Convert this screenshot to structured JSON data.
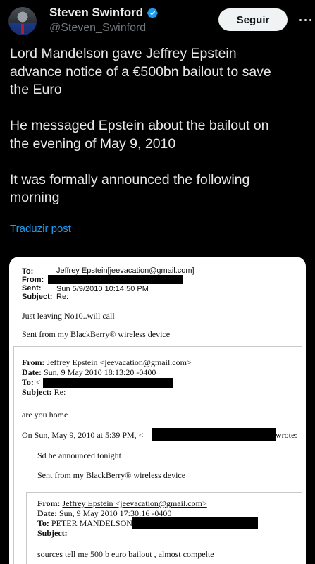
{
  "author": {
    "name": "Steven Swinford",
    "handle": "@Steven_Swinford",
    "verified": true,
    "follow_label": "Seguir"
  },
  "tweet": {
    "para1": [
      "Lord Mandelson gave Jeffrey Epstein",
      "advance notice of a €500bn bailout to save",
      "the Euro"
    ],
    "para2": [
      "He messaged Epstein about the bailout on",
      "the evening of May 9, 2010"
    ],
    "para3": [
      "It was formally announced the following",
      "morning"
    ],
    "translate_label": "Traduzir post"
  },
  "email1": {
    "to_label": "To:",
    "to_value": "Jeffrey Epstein[jeevacation@gmail.com]",
    "from_label": "From:",
    "sent_label": "Sent:",
    "sent_value": "Sun 5/9/2010 10:14:50 PM",
    "subject_label": "Subject:",
    "subject_value": "Re:",
    "body": "Just leaving No10..will call",
    "signature": "Sent from my BlackBerry® wireless device"
  },
  "email2": {
    "from_label": "From:",
    "from_value": "Jeffrey Epstein <jeevacation@gmail.com>",
    "date_label": "Date:",
    "date_value": "Sun, 9 May 2010 18:13:20 -0400",
    "to_label": "To:",
    "to_value": "<",
    "subject_label": "Subject:",
    "subject_value": "Re:",
    "body": "are you home",
    "quote_intro_prefix": "On Sun, May 9, 2010 at 5:39 PM, <",
    "quote_intro_suffix": "wrote:",
    "quote_body": "Sd be announced tonight",
    "quote_signature": "Sent from my BlackBerry® wireless device"
  },
  "email3": {
    "from_label": "From:",
    "from_value": "Jeffrey Epstein <jeevacation@gmail.com>",
    "date_label": "Date:",
    "date_value": "Sun, 9 May 2010 17:30:16 -0400",
    "to_label": "To:",
    "to_value": "PETER MANDELSON",
    "subject_label": "Subject:",
    "body": "sources tell me 500 b euro bailout , almost compelte"
  },
  "colors": {
    "background": "#000000",
    "text": "#e7e9ea",
    "muted": "#71767b",
    "link": "#1d9bf0",
    "verified": "#1d9bf0",
    "redaction": "#000000"
  },
  "icons": [
    "verified-badge-icon",
    "more-options-icon"
  ]
}
